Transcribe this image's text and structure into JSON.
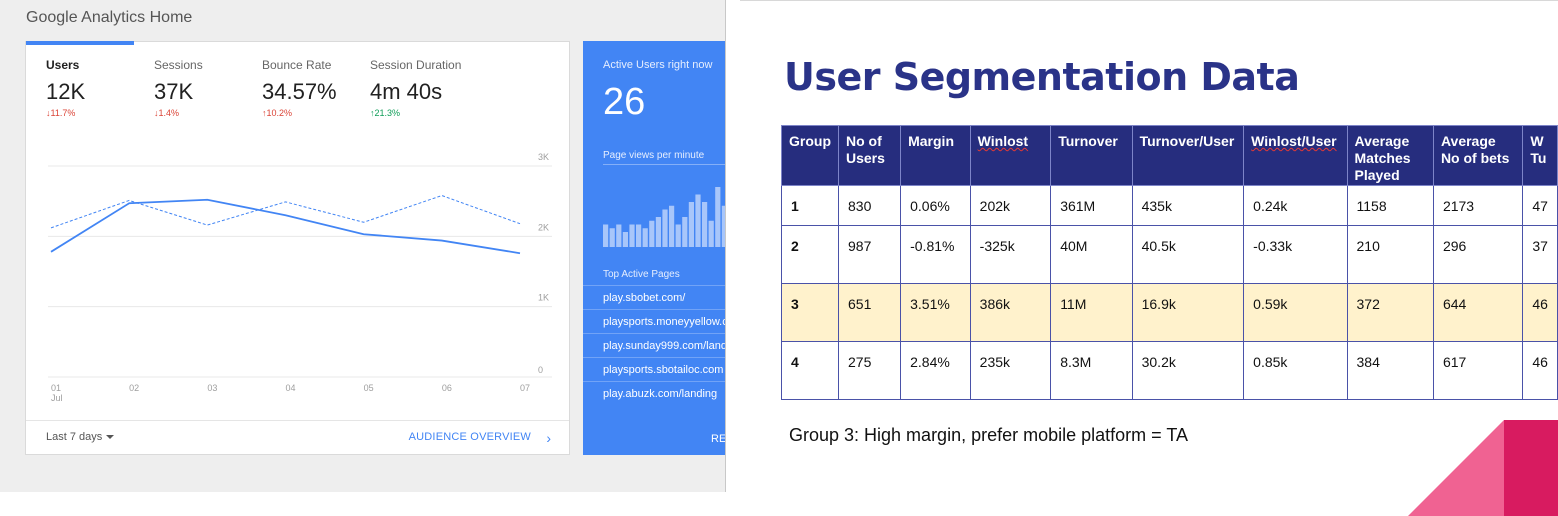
{
  "analytics": {
    "title": "Google Analytics Home",
    "metrics": [
      {
        "label": "Users",
        "value": "12K",
        "delta": "↓11.7%",
        "direction": "down"
      },
      {
        "label": "Sessions",
        "value": "37K",
        "delta": "↓1.4%",
        "direction": "down"
      },
      {
        "label": "Bounce Rate",
        "value": "34.57%",
        "delta": "↑10.2%",
        "direction": "down"
      },
      {
        "label": "Session Duration",
        "value": "4m 40s",
        "delta": "↑21.3%",
        "direction": "up"
      }
    ],
    "chart": {
      "y_ticks": [
        "3K",
        "2K",
        "1K",
        "0"
      ],
      "x_ticks": [
        "01",
        "02",
        "03",
        "04",
        "05",
        "06",
        "07"
      ],
      "x_sub_label": "Jul"
    },
    "footer": {
      "date_range": "Last 7 days",
      "link": "AUDIENCE OVERVIEW"
    },
    "realtime": {
      "label": "Active Users right now",
      "value": "26",
      "pageviews_label": "Page views per minute",
      "top_pages_label": "Top Active Pages",
      "pages": [
        "play.sbobet.com/",
        "playsports.moneyyellow.c",
        "play.sunday999.com/land",
        "playsports.sbotailoc.com",
        "play.abuzk.com/landing"
      ],
      "footer_link": "RE"
    }
  },
  "chart_data": {
    "type": "line",
    "x": [
      "01",
      "02",
      "03",
      "04",
      "05",
      "06",
      "07"
    ],
    "ylim": [
      0,
      3000
    ],
    "y_ticks": [
      0,
      1000,
      2000,
      3000
    ],
    "grid": true,
    "series": [
      {
        "values": [
          1780,
          2470,
          2520,
          2300,
          2030,
          1940,
          1760
        ],
        "style": "solid"
      },
      {
        "values": [
          2120,
          2510,
          2160,
          2490,
          2200,
          2580,
          2180
        ],
        "style": "dashed"
      }
    ],
    "colors": {
      "line": "#4285f4",
      "grid": "#e8e8e8"
    }
  },
  "realtime_bars": [
    3,
    2.5,
    3,
    2,
    3,
    3,
    2.5,
    3.5,
    4,
    5,
    5.5,
    3,
    4,
    6,
    7,
    6,
    3.5,
    8,
    5.5,
    3,
    2,
    1.5
  ],
  "slide": {
    "title": "User Segmentation Data",
    "headers": [
      "Group",
      "No of Users",
      "Margin",
      "Winlost",
      "Turnover",
      "Turnover/User",
      "Winlost/User",
      "Average Matches Played",
      "Average No of bets",
      "W Tu"
    ],
    "rows": [
      [
        "1",
        "830",
        "0.06%",
        "202k",
        "361M",
        "435k",
        "0.24k",
        "1158",
        "2173",
        "47"
      ],
      [
        "2",
        "987",
        "-0.81%",
        "-325k",
        "40M",
        "40.5k",
        "-0.33k",
        "210",
        "296",
        "37"
      ],
      [
        "3",
        "651",
        "3.51%",
        "386k",
        "11M",
        "16.9k",
        "0.59k",
        "372",
        "644",
        "46"
      ],
      [
        "4",
        "275",
        "2.84%",
        "235k",
        "8.3M",
        "30.2k",
        "0.85k",
        "384",
        "617",
        "46"
      ]
    ],
    "highlighted_row": 2,
    "note": "Group 3: High margin, prefer mobile platform = TA",
    "colors": {
      "header": "#262d7e",
      "title": "#2a3388",
      "highlight": "#fff2cc",
      "deco_pink": "#f06292",
      "deco_magenta": "#d81b60"
    }
  }
}
